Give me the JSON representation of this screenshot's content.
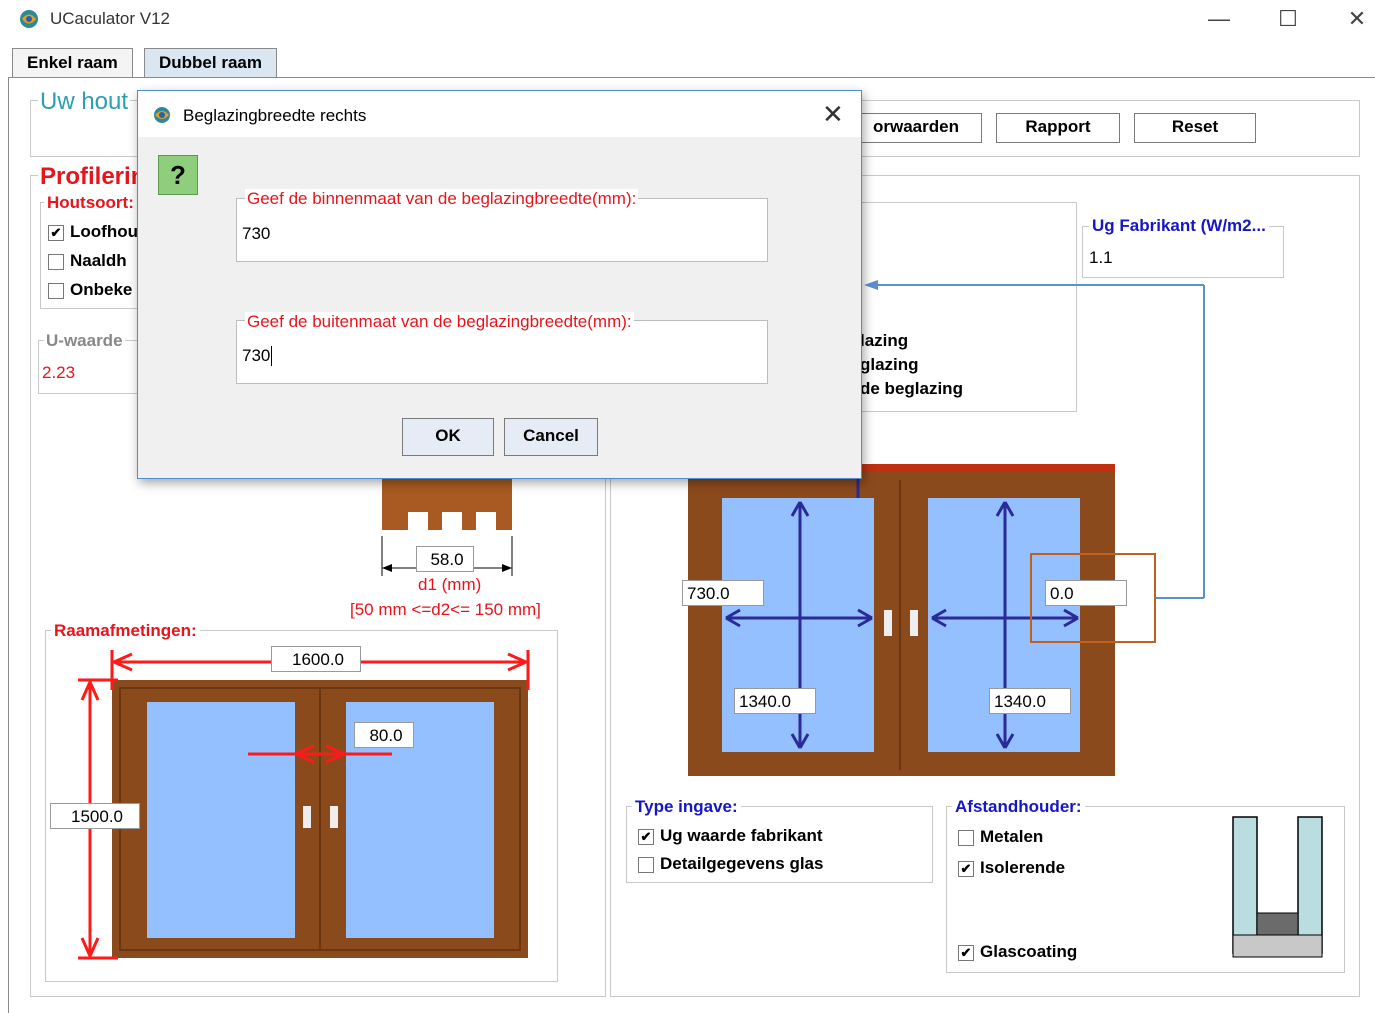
{
  "window": {
    "title": "UCaculator V12",
    "minimize": "—",
    "maximize": "☐",
    "close": "✕"
  },
  "tabs": [
    {
      "label": "Enkel raam"
    },
    {
      "label": "Dubbel raam"
    }
  ],
  "header": {
    "section_title": "Uw hout",
    "buttons": {
      "values_label": "orwaarden",
      "report_label": "Rapport",
      "reset_label": "Reset"
    }
  },
  "profiling": {
    "title": "Profilerin",
    "wood_type_label": "Houtsoort:",
    "wood_options": [
      {
        "label": "Loofhou",
        "checked": true
      },
      {
        "label": "Naaldh",
        "checked": false
      },
      {
        "label": "Onbeke",
        "checked": false
      }
    ],
    "u_value_label": "U-waarde",
    "u_value": "2.23",
    "d1_value": "58.0",
    "d1_label": "d1 (mm)",
    "d2_range": "[50 mm <=d2<= 150 mm]"
  },
  "window_dims": {
    "label": "Raamafmetingen:",
    "width": "1600.0",
    "height": "1500.0",
    "mullion": "80.0"
  },
  "glazing": {
    "ug_label": "Ug Fabrikant (W/m2...",
    "ug_value": "1.1",
    "partial_lines": [
      "lazing",
      "glazing",
      "de beglazing"
    ],
    "left_width": "730.0",
    "right_width": "0.0",
    "left_height": "1340.0",
    "right_height": "1340.0"
  },
  "input_type": {
    "label": "Type ingave:",
    "options": [
      {
        "label": "Ug waarde fabrikant",
        "checked": true
      },
      {
        "label": "Detailgegevens glas",
        "checked": false
      }
    ]
  },
  "spacer": {
    "label": "Afstandhouder:",
    "options": [
      {
        "label": "Metalen",
        "checked": false
      },
      {
        "label": "Isolerende",
        "checked": true
      }
    ],
    "coating_label": "Glascoating",
    "coating_checked": true
  },
  "dialog": {
    "title": "Beglazingbreedte rechts",
    "close": "✕",
    "help": "?",
    "inner_label": "Geef de binnenmaat van de beglazingbreedte(mm):",
    "inner_value": "730",
    "outer_label": "Geef de buitenmaat van de beglazingbreedte(mm):",
    "outer_value": "730",
    "ok_label": "OK",
    "cancel_label": "Cancel"
  },
  "colors": {
    "wood": "#8b4a1c",
    "glass": "#94c0ff",
    "arrow_red": "#ff1a1a",
    "arrow_blue": "#2a2a9a",
    "highlight": "#c0621e"
  }
}
